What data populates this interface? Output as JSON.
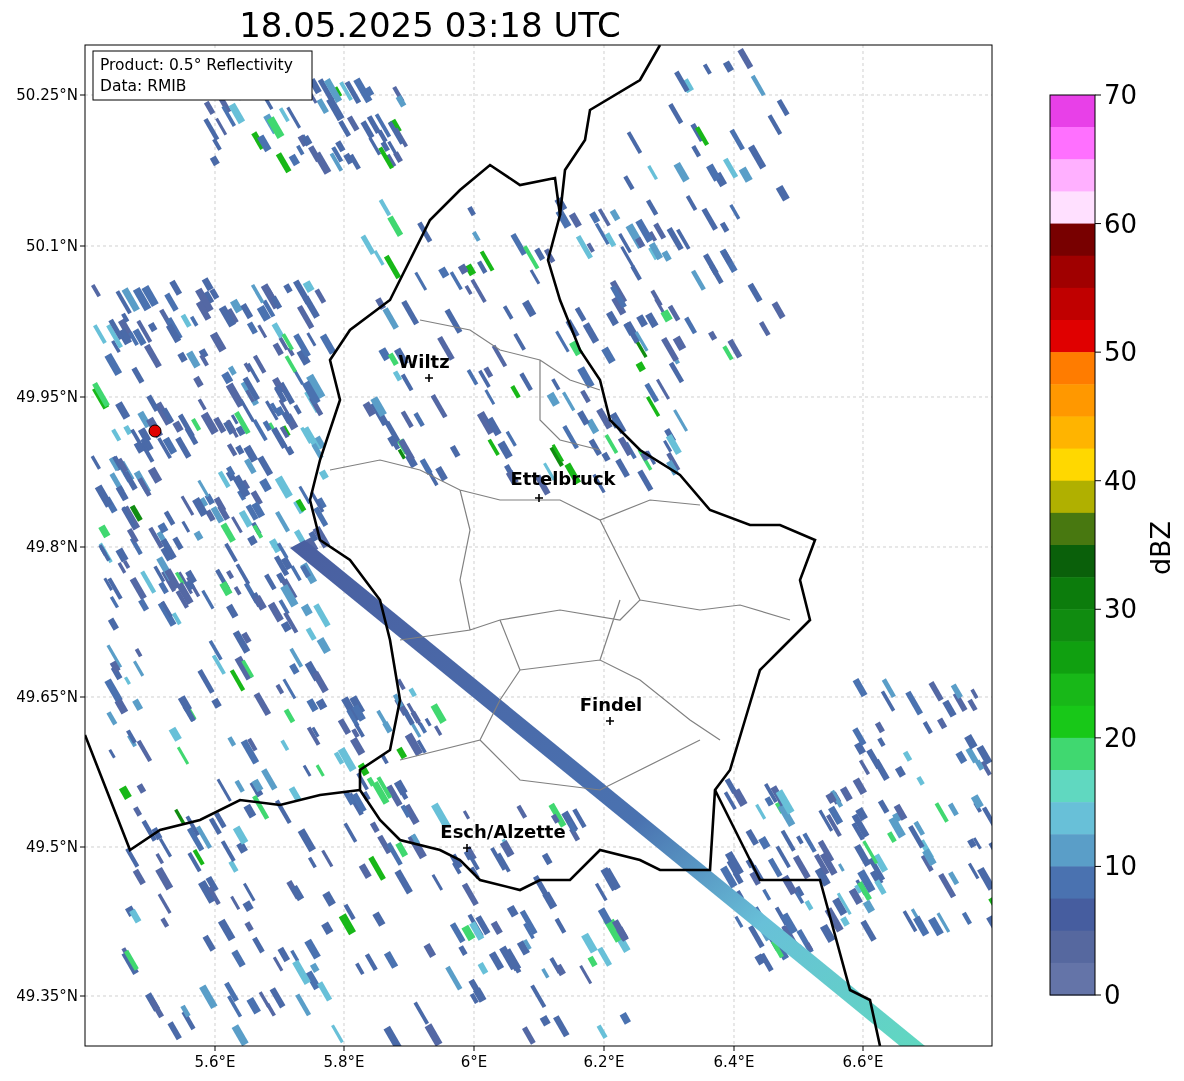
{
  "title": "18.05.2025 03:18 UTC",
  "legend": {
    "lines": [
      "Product: 0.5° Reflectivity",
      "Data: RMIB"
    ]
  },
  "map": {
    "y_ticks": [
      "50.25°N",
      "50.1°N",
      "49.95°N",
      "49.8°N",
      "49.65°N",
      "49.5°N",
      "49.35°N"
    ],
    "x_ticks": [
      "5.6°E",
      "5.8°E",
      "6°E",
      "6.2°E",
      "6.4°E",
      "6.6°E"
    ],
    "cities": [
      {
        "name": "Wiltz"
      },
      {
        "name": "Ettelbruck"
      },
      {
        "name": "Findel"
      },
      {
        "name": "Esch/Alzette"
      }
    ]
  },
  "colorbar": {
    "label": "dBZ",
    "ticks": [
      "70",
      "60",
      "50",
      "40",
      "30",
      "20",
      "10",
      "0"
    ],
    "segments": [
      {
        "color": "#e840e8"
      },
      {
        "color": "#ff70ff"
      },
      {
        "color": "#ffb0ff"
      },
      {
        "color": "#ffe0ff"
      },
      {
        "color": "#780000"
      },
      {
        "color": "#a00000"
      },
      {
        "color": "#c00000"
      },
      {
        "color": "#e00000"
      },
      {
        "color": "#ff7c00"
      },
      {
        "color": "#ff9800"
      },
      {
        "color": "#ffb400"
      },
      {
        "color": "#ffd800"
      },
      {
        "color": "#b0b000"
      },
      {
        "color": "#487810"
      },
      {
        "color": "#0a600a"
      },
      {
        "color": "#0c7c0c"
      },
      {
        "color": "#108c10"
      },
      {
        "color": "#10a010"
      },
      {
        "color": "#18b818"
      },
      {
        "color": "#18c818"
      },
      {
        "color": "#40d870"
      },
      {
        "color": "#60d8c0"
      },
      {
        "color": "#68c0d8"
      },
      {
        "color": "#5a9ec8"
      },
      {
        "color": "#4a72b0"
      },
      {
        "color": "#465d9f"
      },
      {
        "color": "#56689f"
      },
      {
        "color": "#6474a8"
      }
    ]
  }
}
